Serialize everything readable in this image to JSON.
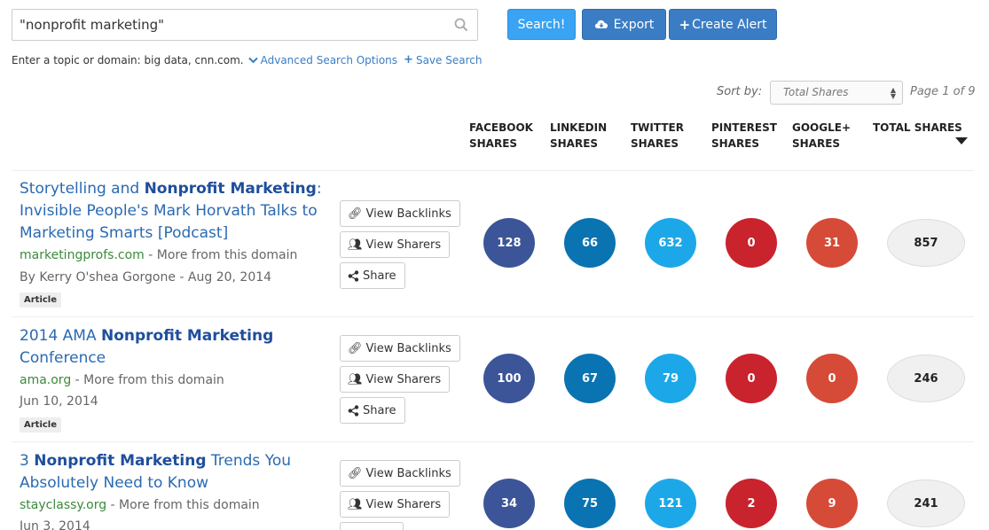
{
  "search": {
    "value": "\"nonprofit marketing\"",
    "search_label": "Search!",
    "export_label": "Export",
    "alert_label": "Create Alert"
  },
  "hint": {
    "text": "Enter a topic or domain: big data, cnn.com.",
    "advanced": "Advanced Search Options",
    "save": "Save Search"
  },
  "sort": {
    "label": "Sort by:",
    "selected": "Total Shares",
    "page": "Page 1 of 9"
  },
  "columns": [
    {
      "line1": "FACEBOOK",
      "line2": "SHARES"
    },
    {
      "line1": "LINKEDIN",
      "line2": "SHARES"
    },
    {
      "line1": "TWITTER",
      "line2": "SHARES"
    },
    {
      "line1": "PINTEREST",
      "line2": "SHARES"
    },
    {
      "line1": "GOOGLE+",
      "line2": "SHARES"
    },
    {
      "line1": "TOTAL SHARES",
      "line2": ""
    }
  ],
  "actions": {
    "backlinks": "View Backlinks",
    "sharers": "View Sharers",
    "share": "Share"
  },
  "results": [
    {
      "title_pre": "Storytelling and ",
      "title_bold": "Nonprofit Marketing",
      "title_post": ": Invisible People's Mark Horvath Talks to Marketing Smarts [Podcast]",
      "domain": "marketingprofs.com",
      "more": " - More from this domain",
      "byline": "By Kerry O'shea Gorgone - Aug 20, 2014",
      "type": "Article",
      "facebook": "128",
      "linkedin": "66",
      "twitter": "632",
      "pinterest": "0",
      "googleplus": "31",
      "total": "857"
    },
    {
      "title_pre": "2014 AMA ",
      "title_bold": "Nonprofit Marketing",
      "title_post": " Conference",
      "domain": "ama.org",
      "more": " - More from this domain",
      "byline": "Jun 10, 2014",
      "type": "Article",
      "facebook": "100",
      "linkedin": "67",
      "twitter": "79",
      "pinterest": "0",
      "googleplus": "0",
      "total": "246"
    },
    {
      "title_pre": "3 ",
      "title_bold": "Nonprofit Marketing",
      "title_post": " Trends You Absolutely Need to Know",
      "domain": "stayclassy.org",
      "more": " - More from this domain",
      "byline": "Jun 3, 2014",
      "type": "",
      "facebook": "34",
      "linkedin": "75",
      "twitter": "121",
      "pinterest": "2",
      "googleplus": "9",
      "total": "241"
    }
  ]
}
